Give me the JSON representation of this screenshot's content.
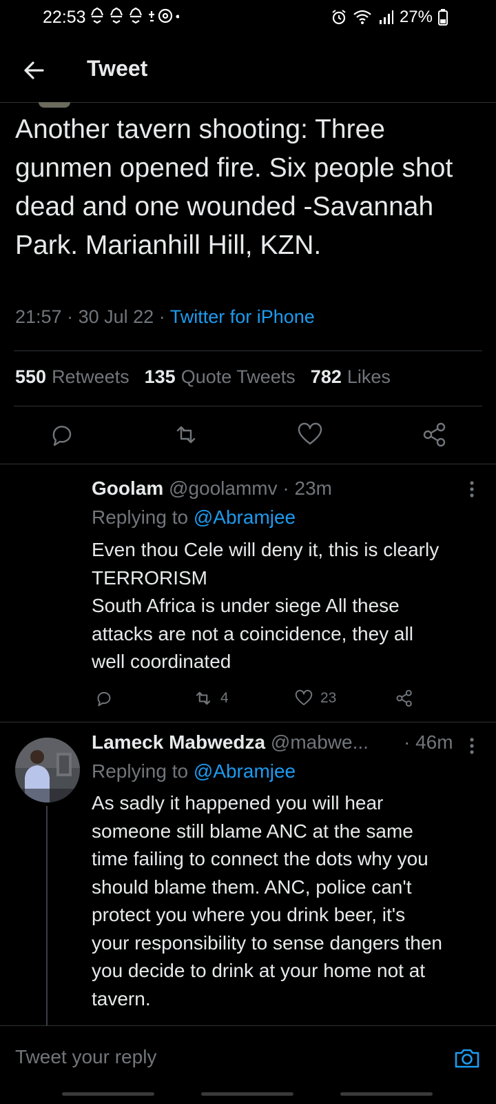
{
  "status_bar": {
    "time": "22:53",
    "battery": "27%"
  },
  "header": {
    "title": "Tweet"
  },
  "tweet": {
    "text": "Another tavern shooting: Three gunmen opened fire. Six people shot dead and one wounded -Savannah Park. Marianhill Hill, KZN.",
    "time": "21:57",
    "date": "30 Jul 22",
    "source": "Twitter for iPhone",
    "retweets_count": "550",
    "retweets_label": "Retweets",
    "quotes_count": "135",
    "quotes_label": "Quote Tweets",
    "likes_count": "782",
    "likes_label": "Likes"
  },
  "replies": [
    {
      "name": "Goolam",
      "handle": "@goolammv",
      "age": "23m",
      "replying_prefix": "Replying to",
      "replying_to": "@Abramjee",
      "text_lines": [
        "Even thou Cele will deny it, this is clearly",
        "TERRORISM",
        "South Africa is under siege All these",
        "attacks are not a coincidence, they all",
        "well coordinated"
      ],
      "retweets": "4",
      "likes": "23"
    },
    {
      "name": "Lameck Mabwedza",
      "handle": "@mabwe...",
      "age": "46m",
      "replying_prefix": "Replying to",
      "replying_to": "@Abramjee",
      "text_lines": [
        "As sadly it happened you will hear",
        "someone still blame ANC at the same",
        "time failing to connect the dots why you",
        "should blame them. ANC, police  can't",
        "protect you where you drink beer, it's",
        "your responsibility to sense dangers then",
        "you decide to drink at your home not at",
        "tavern."
      ]
    }
  ],
  "composer": {
    "placeholder": "Tweet your reply"
  },
  "colors": {
    "accent": "#1d9bf0",
    "background": "#000000",
    "muted": "#71767b"
  },
  "icons": [
    "back-arrow-icon",
    "reply-icon",
    "retweet-icon",
    "like-icon",
    "share-icon",
    "more-icon",
    "camera-icon"
  ]
}
